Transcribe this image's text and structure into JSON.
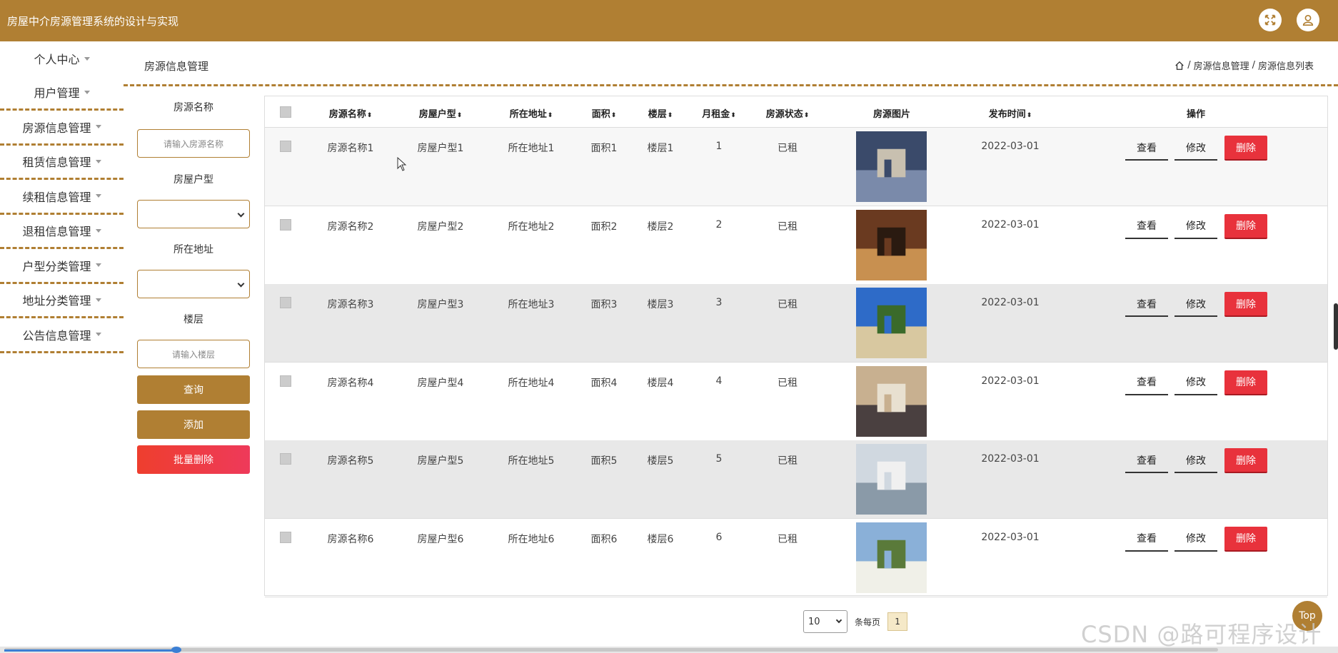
{
  "header": {
    "title": "房屋中介房源管理系统的设计与实现",
    "fullscreen_icon": "expand-icon",
    "user_icon": "user-icon",
    "accent": "#b07f33"
  },
  "sidebar": {
    "items": [
      {
        "label": "个人中心"
      },
      {
        "label": "用户管理"
      },
      {
        "label": "房源信息管理"
      },
      {
        "label": "租赁信息管理"
      },
      {
        "label": "续租信息管理"
      },
      {
        "label": "退租信息管理"
      },
      {
        "label": "户型分类管理"
      },
      {
        "label": "地址分类管理"
      },
      {
        "label": "公告信息管理"
      }
    ]
  },
  "page": {
    "title": "房源信息管理"
  },
  "breadcrumb": {
    "items": [
      "房源信息管理",
      "房源信息列表"
    ],
    "sep": "/"
  },
  "search": {
    "name_label": "房源名称",
    "name_placeholder": "请输入房源名称",
    "type_label": "房屋户型",
    "type_value": "",
    "address_label": "所在地址",
    "address_value": "",
    "floor_label": "楼层",
    "floor_placeholder": "请输入楼层",
    "query_button": "查询",
    "add_button": "添加",
    "batch_delete_button": "批量删除"
  },
  "table": {
    "columns": [
      "房源名称",
      "房屋户型",
      "所在地址",
      "面积",
      "楼层",
      "月租金",
      "房源状态",
      "房源图片",
      "发布时间",
      "操作"
    ],
    "rows": [
      {
        "name": "房源名称1",
        "type": "房屋户型1",
        "address": "所在地址1",
        "area": "面积1",
        "floor": "楼层1",
        "rent": "1",
        "status": "已租",
        "date": "2022-03-01"
      },
      {
        "name": "房源名称2",
        "type": "房屋户型2",
        "address": "所在地址2",
        "area": "面积2",
        "floor": "楼层2",
        "rent": "2",
        "status": "已租",
        "date": "2022-03-01"
      },
      {
        "name": "房源名称3",
        "type": "房屋户型3",
        "address": "所在地址3",
        "area": "面积3",
        "floor": "楼层3",
        "rent": "3",
        "status": "已租",
        "date": "2022-03-01"
      },
      {
        "name": "房源名称4",
        "type": "房屋户型4",
        "address": "所在地址4",
        "area": "面积4",
        "floor": "楼层4",
        "rent": "4",
        "status": "已租",
        "date": "2022-03-01"
      },
      {
        "name": "房源名称5",
        "type": "房屋户型5",
        "address": "所在地址5",
        "area": "面积5",
        "floor": "楼层5",
        "rent": "5",
        "status": "已租",
        "date": "2022-03-01"
      },
      {
        "name": "房源名称6",
        "type": "房屋户型6",
        "address": "所在地址6",
        "area": "面积6",
        "floor": "楼层6",
        "rent": "6",
        "status": "已租",
        "date": "2022-03-01"
      }
    ],
    "actions": {
      "view": "查看",
      "edit": "修改",
      "delete": "删除"
    }
  },
  "pagination": {
    "page_size": "10",
    "per_page_label": "条每页",
    "current_page": "1"
  },
  "totop": "Top",
  "watermark": "CSDN @路可程序设计"
}
